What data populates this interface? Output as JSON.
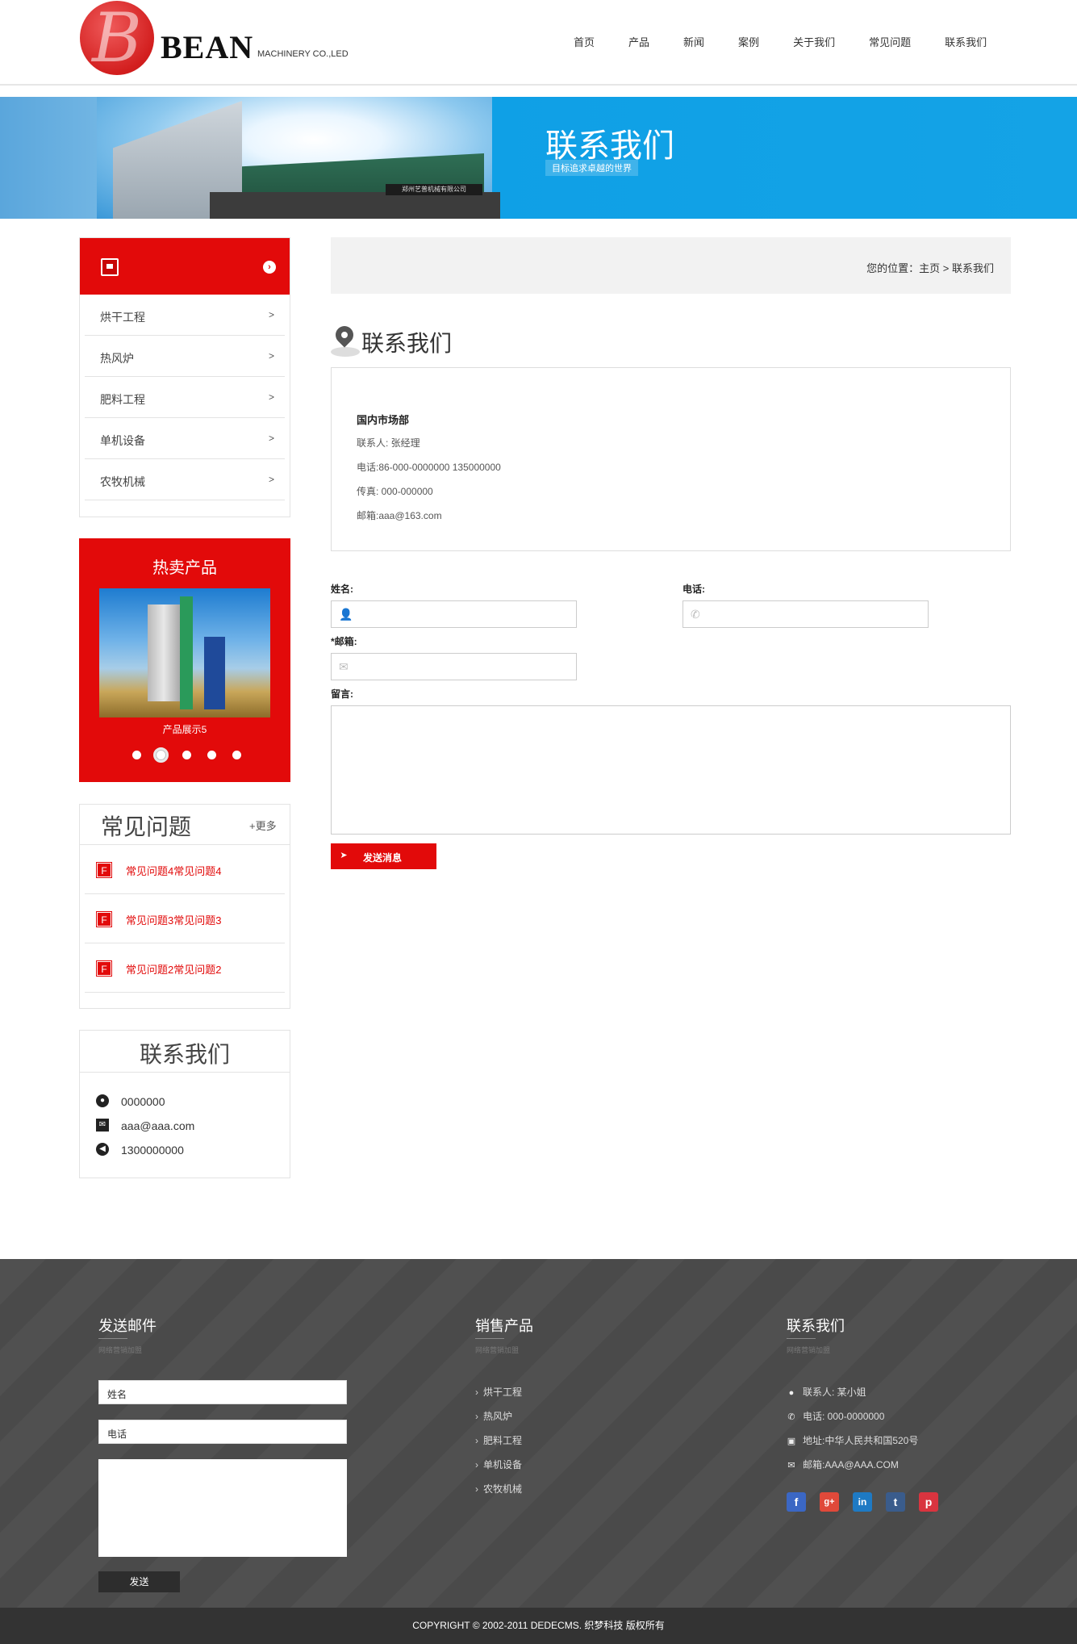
{
  "header": {
    "logo_letter": "B",
    "logo_text": "BEAN",
    "logo_sub": "MACHINERY CO.,LED",
    "nav": [
      "首页",
      "产品",
      "新闻",
      "案例",
      "关于我们",
      "常见问题",
      "联系我们"
    ]
  },
  "banner": {
    "title": "联系我们",
    "subtitle": "目标追求卓越的世界",
    "sign": "郑州艺普机械有限公司"
  },
  "sidebar": {
    "menu": [
      {
        "label": "烘干工程",
        "arrow": ">"
      },
      {
        "label": "热风炉",
        "arrow": ">"
      },
      {
        "label": "肥料工程",
        "arrow": ">"
      },
      {
        "label": "单机设备",
        "arrow": ">"
      },
      {
        "label": "农牧机械",
        "arrow": ">"
      }
    ],
    "hot": {
      "title": "热卖产品",
      "caption": "产品展示5",
      "dots": 5,
      "active_dot": 2
    },
    "faq": {
      "title": "常见问题",
      "more": "+更多",
      "badge": "F",
      "items": [
        "常见问题4常见问题4",
        "常见问题3常见问题3",
        "常见问题2常见问题2"
      ]
    },
    "contact": {
      "title": "联系我们",
      "qq": "0000000",
      "email": "aaa@aaa.com",
      "phone": "1300000000"
    }
  },
  "main": {
    "breadcrumb": "您的位置：主页 > 联系我们",
    "title": "联系我们",
    "info": {
      "dept": "国内市场部",
      "contact": "联系人: 张经理",
      "phone": "电话:86-000-0000000 135000000",
      "fax": "传真: 000-000000",
      "email": "邮箱:aaa@163.com"
    },
    "form": {
      "name_label": "姓名:",
      "phone_label": "电话:",
      "email_label": "*邮箱:",
      "message_label": "留言:",
      "name_value": "",
      "phone_value": "",
      "email_value": "",
      "message_value": "",
      "send_label": "发送消息"
    }
  },
  "footer": {
    "mail": {
      "title": "发送邮件",
      "sub": "网络营销加盟",
      "name_placeholder": "姓名",
      "phone_placeholder": "电话",
      "send": "发送"
    },
    "products": {
      "title": "销售产品",
      "sub": "网络营销加盟",
      "items": [
        "烘干工程",
        "热风炉",
        "肥料工程",
        "单机设备",
        "农牧机械"
      ]
    },
    "contact": {
      "title": "联系我们",
      "sub": "网络营销加盟",
      "person": "联系人: 某小姐",
      "phone": "电话: 000-0000000",
      "address": "地址:中华人民共和国520号",
      "email": "邮箱:AAA@AAA.COM"
    },
    "social": [
      {
        "name": "facebook",
        "glyph": "f",
        "color": "#3b67c4"
      },
      {
        "name": "google-plus",
        "glyph": "g+",
        "color": "#e0493a"
      },
      {
        "name": "linkedin",
        "glyph": "in",
        "color": "#1e7ac4"
      },
      {
        "name": "tumblr",
        "glyph": "t",
        "color": "#3a5c8c"
      },
      {
        "name": "pinterest",
        "glyph": "p",
        "color": "#d9343f"
      }
    ],
    "copyright": "COPYRIGHT © 2002-2011 DEDECMS. 织梦科技 版权所有"
  },
  "colors": {
    "accent": "#e20a0a",
    "banner_blue": "#14a3e6",
    "footer_bg": "#4d4d4d",
    "copyright_bg": "#333333"
  },
  "icons": {
    "side_menu_head": "truck-icon",
    "side_menu_arrow": "chevron-right-circle-icon",
    "contact_title": "map-pin-icon",
    "name_field": "user-icon",
    "phone_field": "phone-icon",
    "email_field": "envelope-icon",
    "send": "paper-plane-icon"
  }
}
